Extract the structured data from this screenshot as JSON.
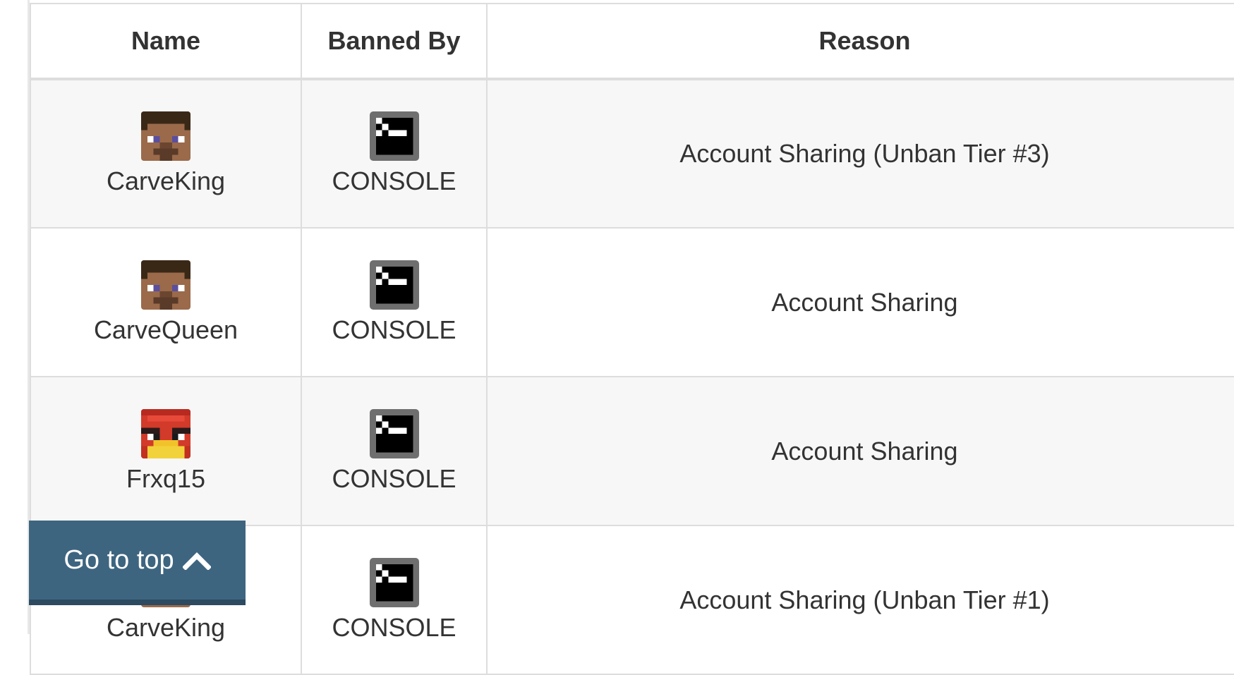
{
  "table": {
    "headers": {
      "name": "Name",
      "banned_by": "Banned By",
      "reason": "Reason"
    },
    "rows": [
      {
        "name": "CarveKing",
        "banned_by": "CONSOLE",
        "reason": "Account Sharing (Unban Tier #3)",
        "avatar_icon": "steve-head-icon"
      },
      {
        "name": "CarveQueen",
        "banned_by": "CONSOLE",
        "reason": "Account Sharing",
        "avatar_icon": "steve-head-icon"
      },
      {
        "name": "Frxq15",
        "banned_by": "CONSOLE",
        "reason": "Account Sharing",
        "avatar_icon": "red-bird-head-icon"
      },
      {
        "name": "CarveKing",
        "banned_by": "CONSOLE",
        "reason": "Account Sharing (Unban Tier #1)",
        "avatar_icon": "steve-head-icon"
      }
    ]
  },
  "go_top": {
    "label": "Go to top",
    "icon": "chevron-up-icon",
    "color": "#3e6580"
  }
}
